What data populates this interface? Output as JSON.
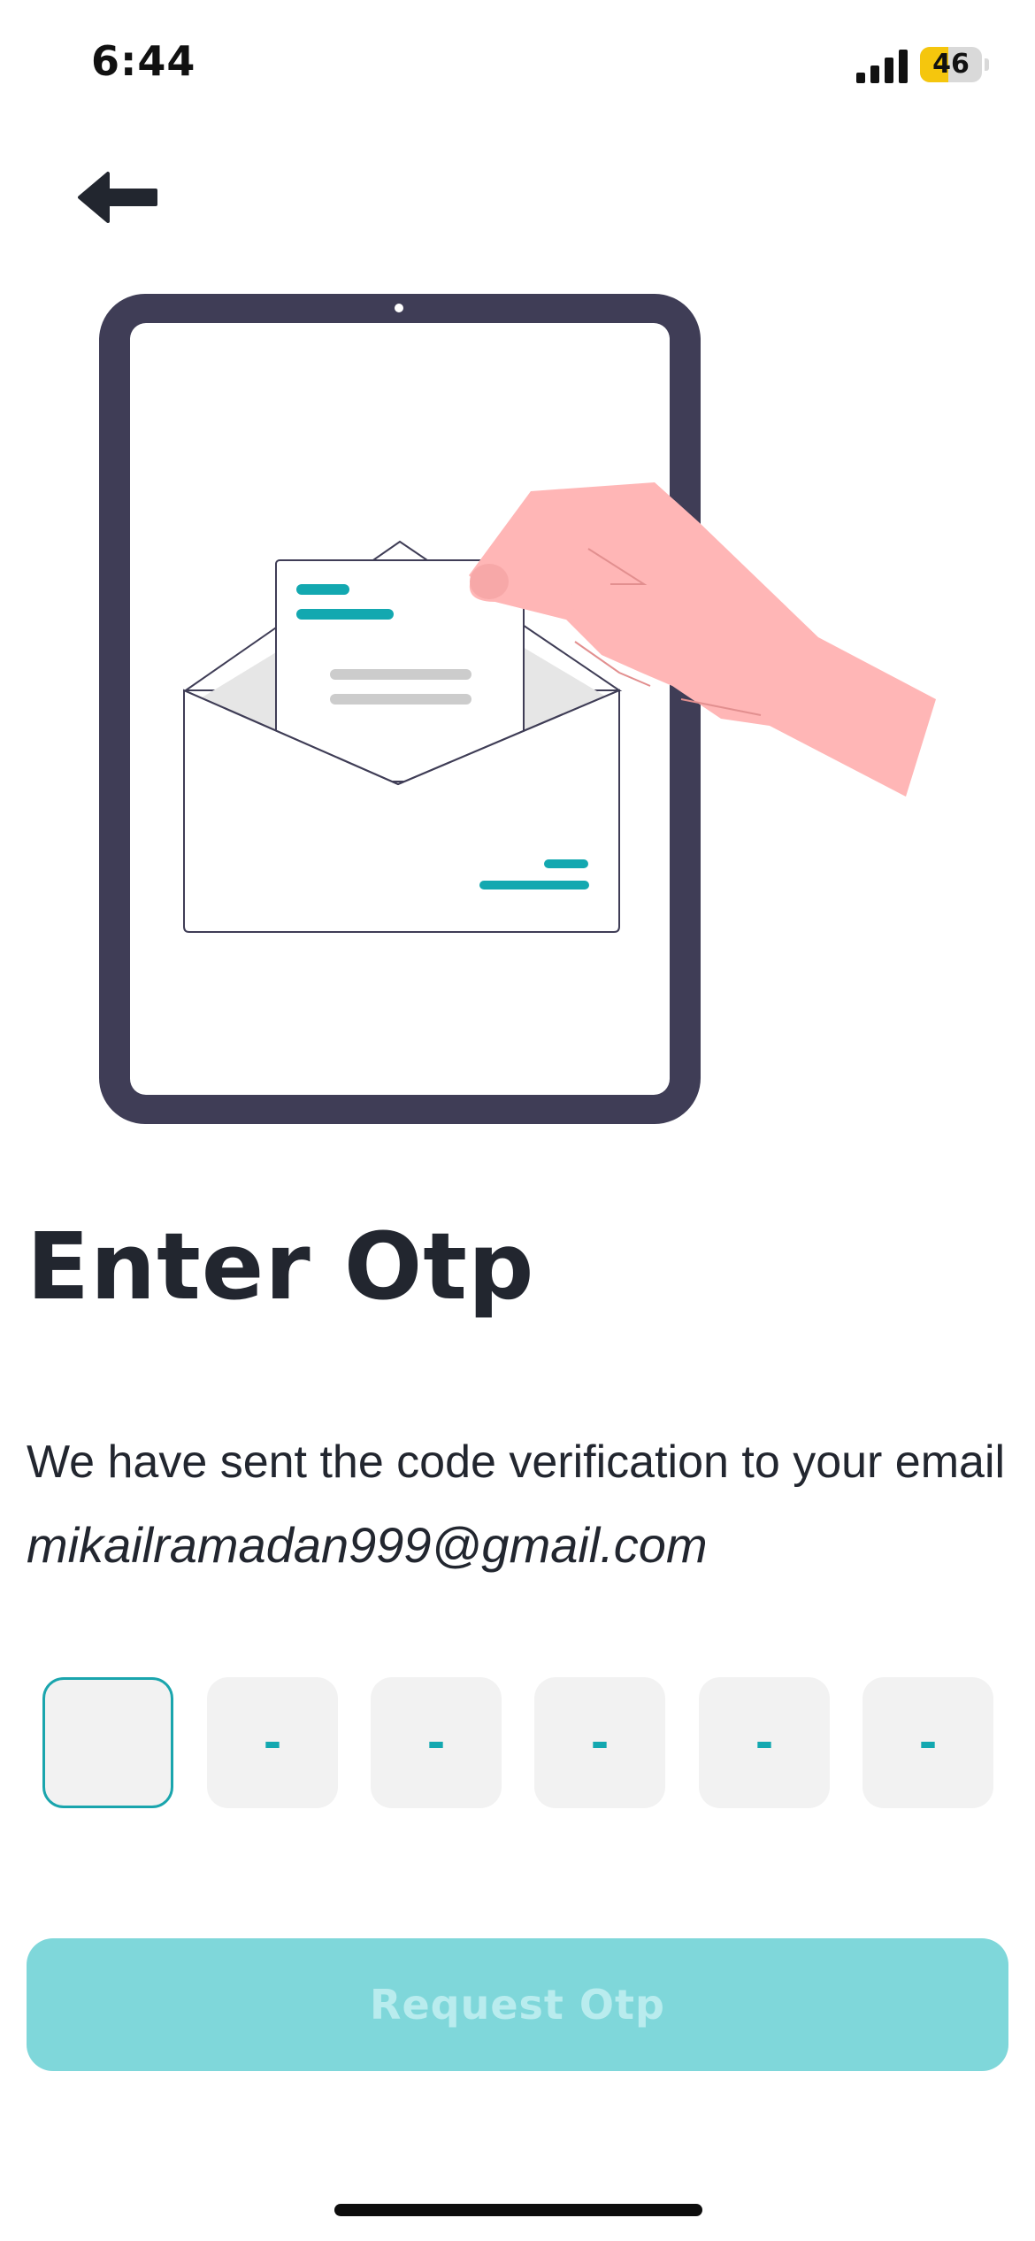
{
  "status_bar": {
    "time": "6:44",
    "battery_level": "46",
    "battery_fraction": 0.46
  },
  "navigation": {
    "back_icon": "arrow-left-icon"
  },
  "illustration": {
    "icon": "tablet-envelope-hand-illustration",
    "colors": {
      "device": "#3f3d56",
      "hand": "#ffb6b6",
      "accent": "#13a8b0",
      "paper_lines": "#cccccc",
      "envelope_shade": "#e6e6e6"
    }
  },
  "otp": {
    "title": "Enter Otp",
    "description": "We have sent the code verification to your email",
    "email": "mikailramadan999@gmail.com",
    "digits": [
      "",
      "-",
      "-",
      "-",
      "-",
      "-"
    ],
    "active_index": 0
  },
  "actions": {
    "request_label": "Request Otp"
  },
  "colors": {
    "accent": "#13a8b0",
    "button_bg": "#7fd7da",
    "button_text": "#b9ecee",
    "input_bg": "#f2f2f2",
    "title_text": "#22262f"
  }
}
